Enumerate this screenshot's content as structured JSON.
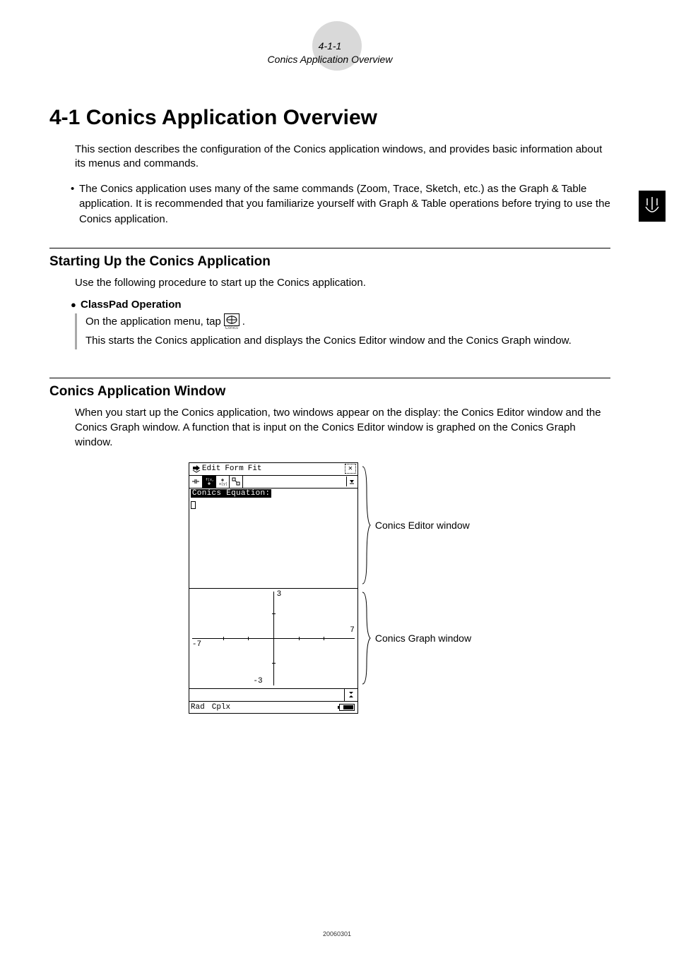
{
  "header": {
    "page_num": "4-1-1",
    "running_title": "Conics Application Overview"
  },
  "main_title": "4-1  Conics Application Overview",
  "intro": "This section describes the configuration of the Conics application windows, and provides basic information about its menus and commands.",
  "bullet1": "The Conics application uses many of the same commands (Zoom, Trace, Sketch, etc.) as the Graph & Table application. It is recommended that you familiarize yourself with Graph & Table operations before trying to use the Conics application.",
  "section1": {
    "heading": "Starting Up the Conics Application",
    "sub": "Use the following procedure to start up the Conics application.",
    "op_heading": "ClassPad Operation",
    "line1_a": "On the application menu, tap ",
    "line1_b": " .",
    "icon_label": "Conics",
    "line2": "This starts the Conics application and displays the Conics Editor window and the Conics Graph window."
  },
  "section2": {
    "heading": "Conics Application Window",
    "sub": "When you start up the Conics application, two windows appear on the display: the Conics Editor window and the Conics Graph window. A function that is input on the Conics Editor window is graphed on the Conics Graph window."
  },
  "device": {
    "menus": {
      "m1": "Edit",
      "m2": "Form",
      "m3": "Fit"
    },
    "editor_label": "Conics Equation:",
    "graph": {
      "top": "3",
      "right": "7",
      "left": "-7",
      "bottom": "-3"
    },
    "status": {
      "mode1": "Rad",
      "mode2": "Cplx"
    }
  },
  "callouts": {
    "editor": "Conics Editor window",
    "graph": "Conics Graph window"
  },
  "footer": "20060301"
}
